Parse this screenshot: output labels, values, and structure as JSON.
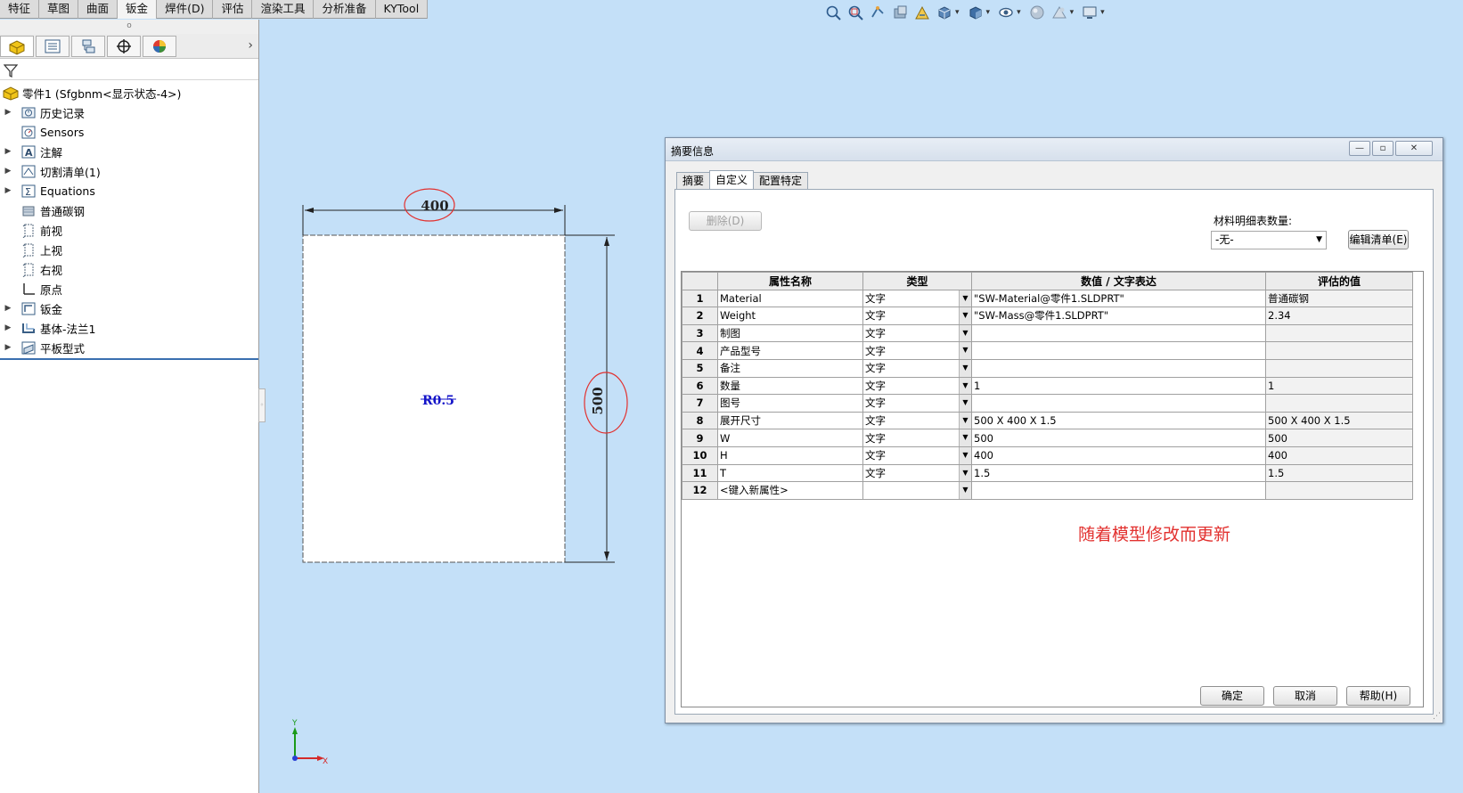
{
  "command_tabs": [
    "特征",
    "草图",
    "曲面",
    "钣金",
    "焊件(D)",
    "评估",
    "渲染工具",
    "分析准备",
    "KYTool"
  ],
  "active_command_tab": "钣金",
  "feature_tree": {
    "root": "零件1 (Sfgbnm<显示状态-4>)",
    "items": [
      {
        "label": "历史记录",
        "icon": "history-folder-icon",
        "expand": true
      },
      {
        "label": "Sensors",
        "icon": "sensors-icon",
        "expand": false
      },
      {
        "label": "注解",
        "icon": "annotations-icon",
        "expand": true
      },
      {
        "label": "切割清单(1)",
        "icon": "cut-list-icon",
        "expand": true
      },
      {
        "label": "Equations",
        "icon": "equations-icon",
        "expand": true
      },
      {
        "label": "普通碳钢",
        "icon": "material-icon",
        "expand": false
      },
      {
        "label": "前视",
        "icon": "plane-icon",
        "expand": false
      },
      {
        "label": "上视",
        "icon": "plane-icon",
        "expand": false
      },
      {
        "label": "右视",
        "icon": "plane-icon",
        "expand": false
      },
      {
        "label": "原点",
        "icon": "origin-icon",
        "expand": false
      },
      {
        "label": "钣金",
        "icon": "sheet-metal-icon",
        "expand": true
      },
      {
        "label": "基体-法兰1",
        "icon": "base-flange-icon",
        "expand": true
      },
      {
        "label": "平板型式",
        "icon": "flat-pattern-icon",
        "expand": true
      }
    ]
  },
  "drawing": {
    "dim_width": "400",
    "dim_height": "500",
    "radius_label": "R0.5",
    "axis_y": "Y",
    "axis_x": "X",
    "annotation": "随着模型修改而更新"
  },
  "dialog": {
    "title": "摘要信息",
    "win_min": "—",
    "win_max": "▫",
    "win_close": "✕",
    "tabs": [
      "摘要",
      "自定义",
      "配置特定"
    ],
    "active_tab": "自定义",
    "delete_button": "删除(D)",
    "bom_label": "材料明细表数量:",
    "bom_value": "-无-",
    "edit_list_button": "编辑清单(E)",
    "columns": [
      "",
      "属性名称",
      "类型",
      "数值 / 文字表达",
      "评估的值"
    ],
    "rows": [
      {
        "num": "1",
        "name": "Material",
        "type": "文字",
        "value": "\"SW-Material@零件1.SLDPRT\"",
        "evaluated": "普通碳钢"
      },
      {
        "num": "2",
        "name": "Weight",
        "type": "文字",
        "value": "\"SW-Mass@零件1.SLDPRT\"",
        "evaluated": "2.34"
      },
      {
        "num": "3",
        "name": "制图",
        "type": "文字",
        "value": "",
        "evaluated": ""
      },
      {
        "num": "4",
        "name": "产品型号",
        "type": "文字",
        "value": "",
        "evaluated": ""
      },
      {
        "num": "5",
        "name": "备注",
        "type": "文字",
        "value": "",
        "evaluated": ""
      },
      {
        "num": "6",
        "name": "数量",
        "type": "文字",
        "value": "1",
        "evaluated": "1"
      },
      {
        "num": "7",
        "name": "图号",
        "type": "文字",
        "value": "",
        "evaluated": ""
      },
      {
        "num": "8",
        "name": "展开尺寸",
        "type": "文字",
        "value": "500 X 400 X 1.5",
        "evaluated": "500 X 400 X 1.5"
      },
      {
        "num": "9",
        "name": "W",
        "type": "文字",
        "value": "500",
        "evaluated": "500"
      },
      {
        "num": "10",
        "name": "H",
        "type": "文字",
        "value": "400",
        "evaluated": "400"
      },
      {
        "num": "11",
        "name": "T",
        "type": "文字",
        "value": "1.5",
        "evaluated": "1.5"
      },
      {
        "num": "12",
        "name": "<键入新属性>",
        "type": "",
        "value": "",
        "evaluated": ""
      }
    ],
    "ok_button": "确定",
    "cancel_button": "取消",
    "help_button": "帮助(H)"
  },
  "colors": {
    "viewport_bg": "#c4e0f8",
    "annotation_red": "#e2312f",
    "dimension_blue": "#1414c8"
  }
}
